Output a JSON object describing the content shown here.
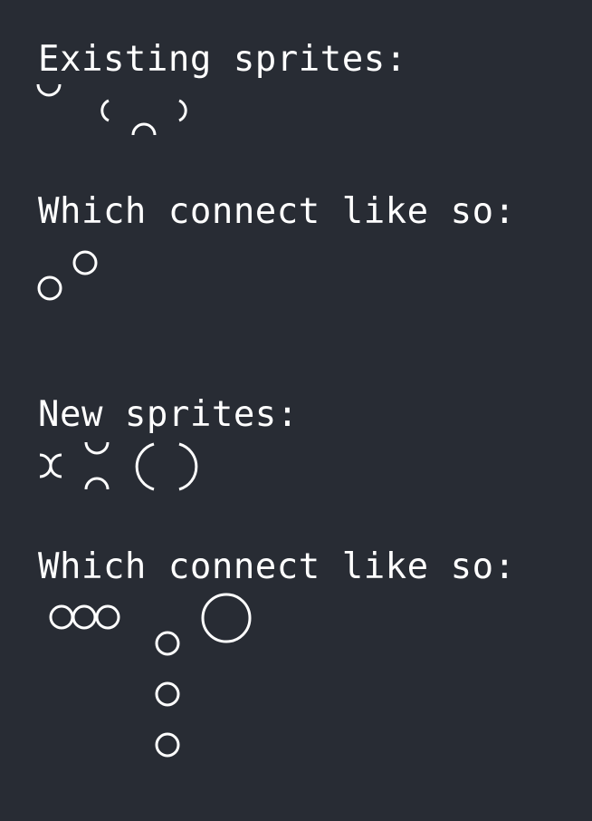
{
  "headings": {
    "existing": "Existing sprites:",
    "existing_connect": "Which connect like so:",
    "new": "New sprites:",
    "new_connect": "Which connect like so:"
  },
  "colors": {
    "background": "#282c34",
    "foreground": "#ffffff"
  },
  "sprites": {
    "existing": [
      "cup-arc",
      "left-arc",
      "cap-arc",
      "right-arc"
    ],
    "new": [
      "x-arcs",
      "cup-arc",
      "cap-arc",
      "big-left-arc",
      "big-right-arc"
    ]
  },
  "connections": {
    "existing": [
      "small-circle",
      "small-circle"
    ],
    "new": [
      "circle-chain-horizontal",
      "circle-column-vertical",
      "large-circle"
    ]
  }
}
